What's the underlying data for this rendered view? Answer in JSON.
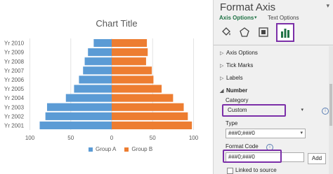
{
  "chart_data": {
    "type": "bar",
    "orientation": "horizontal",
    "title": "Chart Title",
    "categories": [
      "Yr 2001",
      "Yr 2002",
      "Yr 2003",
      "Yr 2004",
      "Yr 2005",
      "Yr 2006",
      "Yr 2007",
      "Yr 2008",
      "Yr 2009",
      "Yr 2010"
    ],
    "series": [
      {
        "name": "Group A",
        "color": "#5b9bd5",
        "values": [
          88,
          81,
          79,
          56,
          46,
          40,
          35,
          33,
          29,
          22
        ]
      },
      {
        "name": "Group B",
        "color": "#ed7d31",
        "values": [
          98,
          93,
          88,
          75,
          61,
          51,
          49,
          42,
          44,
          43
        ]
      }
    ],
    "xaxis_ticks": [
      "100",
      "50",
      "0",
      "50",
      "100"
    ],
    "xlim": [
      -100,
      100
    ],
    "legend_position": "bottom",
    "grid": true
  },
  "pane": {
    "title": "Format Axis",
    "tab_axis_options": "Axis Options",
    "tab_text_options": "Text Options",
    "sections": {
      "axis_options": "Axis Options",
      "tick_marks": "Tick Marks",
      "labels": "Labels",
      "number": "Number"
    },
    "category_label": "Category",
    "category_value": "Custom",
    "type_label": "Type",
    "type_value": "###0;###0",
    "format_code_label": "Format Code",
    "format_code_value": "###0;###0",
    "add_button": "Add",
    "linked_to_source": "Linked to source",
    "highlight_color": "#7b2fa8",
    "accent_color": "#217346"
  }
}
